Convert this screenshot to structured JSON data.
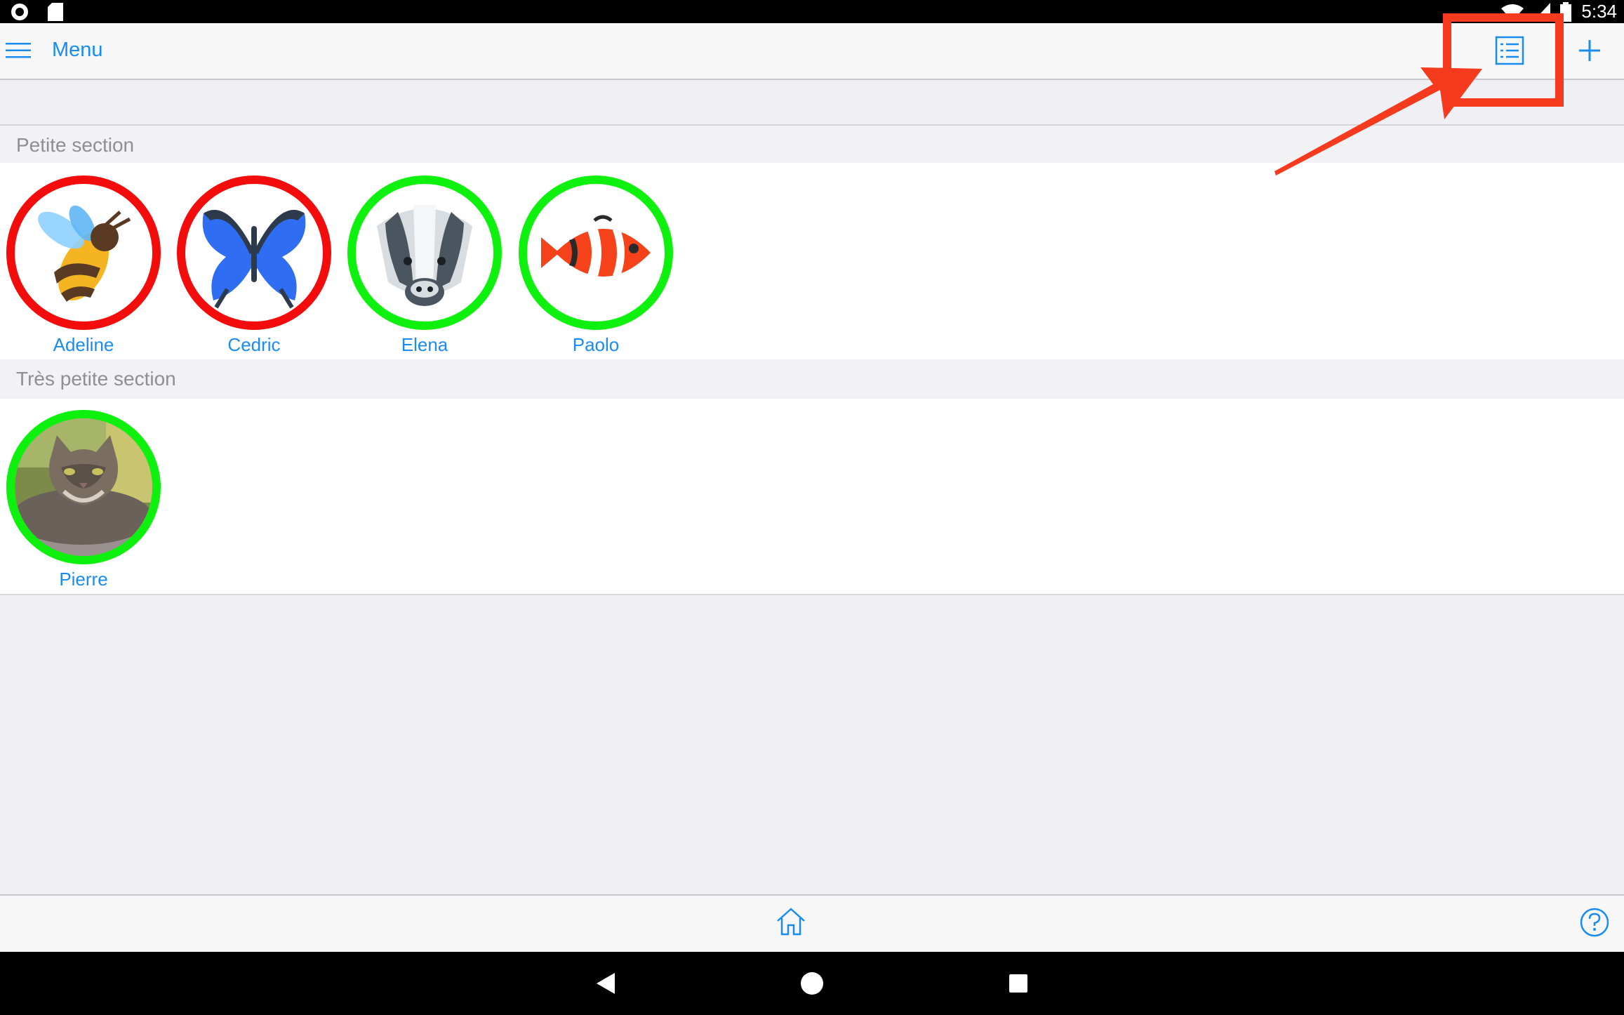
{
  "status_bar": {
    "time": "5:34",
    "left_icons": [
      "record-icon",
      "sd-card-icon"
    ],
    "right_icons": [
      "wifi-icon",
      "signal-icon",
      "battery-icon"
    ]
  },
  "top_bar": {
    "menu_label": "Menu",
    "menu_icon": "hamburger-icon",
    "list_icon": "list-view-icon",
    "add_icon": "plus-icon"
  },
  "sections": [
    {
      "title": "Petite section",
      "students": [
        {
          "name": "Adeline",
          "avatar": "bee",
          "status": "red"
        },
        {
          "name": "Cedric",
          "avatar": "butterfly",
          "status": "red"
        },
        {
          "name": "Elena",
          "avatar": "badger",
          "status": "green"
        },
        {
          "name": "Paolo",
          "avatar": "clownfish",
          "status": "green"
        }
      ]
    },
    {
      "title": "Très petite section",
      "students": [
        {
          "name": "Pierre",
          "avatar": "cat-photo",
          "status": "green"
        }
      ]
    }
  ],
  "bottom_bar": {
    "home_icon": "home-icon",
    "help_icon": "help-icon"
  },
  "nav_bar": {
    "icons": [
      "back-icon",
      "home-circle-icon",
      "recents-icon"
    ]
  },
  "colors": {
    "accent": "#1a8cf0",
    "status_red": "#f20c0c",
    "status_green": "#0ef00e",
    "annotation": "#f53a1e"
  }
}
